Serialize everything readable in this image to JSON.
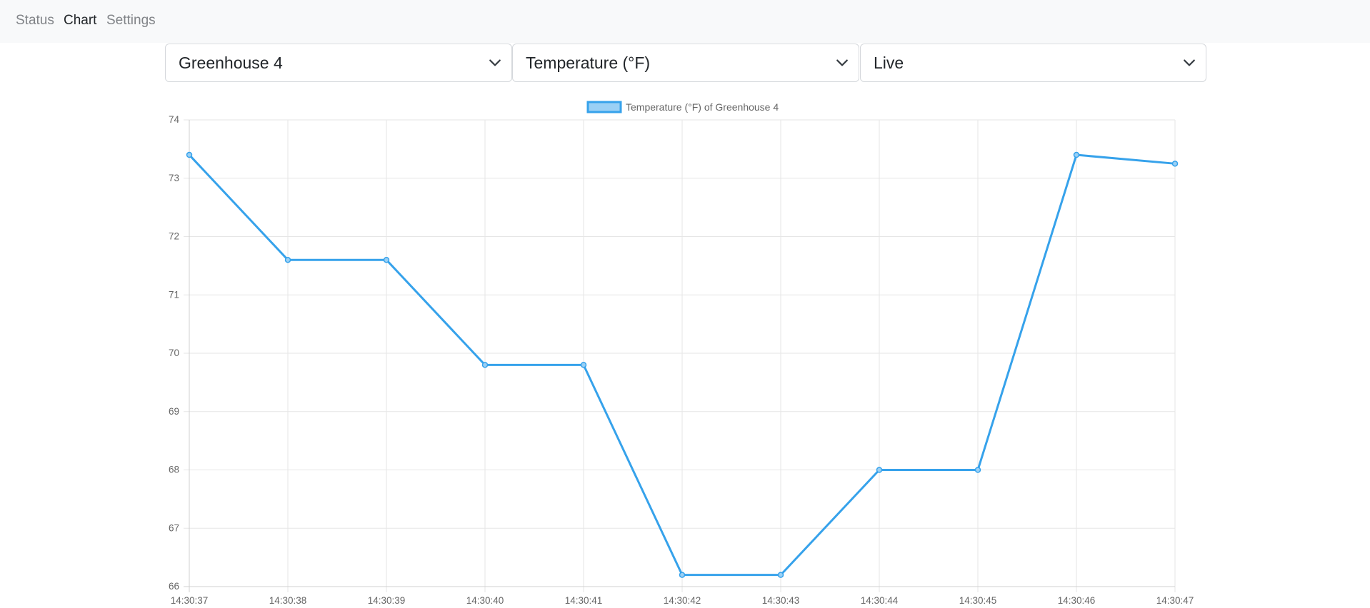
{
  "nav": {
    "items": [
      {
        "label": "Status",
        "active": false
      },
      {
        "label": "Chart",
        "active": true
      },
      {
        "label": "Settings",
        "active": false
      }
    ]
  },
  "controls": {
    "location": "Greenhouse 4",
    "metric": "Temperature (°F)",
    "range": "Live"
  },
  "colors": {
    "series": "#36a2eb",
    "series_fill": "#9ad0f5",
    "grid": "#e6e6e6",
    "navbar_bg": "#f8f9fa"
  },
  "chart_data": {
    "type": "line",
    "title": "",
    "xlabel": "",
    "ylabel": "",
    "x": [
      "14:30:37",
      "14:30:38",
      "14:30:39",
      "14:30:40",
      "14:30:41",
      "14:30:42",
      "14:30:43",
      "14:30:44",
      "14:30:45",
      "14:30:46",
      "14:30:47"
    ],
    "series": [
      {
        "name": "Temperature (°F) of Greenhouse 4",
        "values": [
          73.4,
          71.6,
          71.6,
          69.8,
          69.8,
          66.2,
          66.2,
          68.0,
          68.0,
          73.4,
          73.25
        ]
      }
    ],
    "ylim": [
      66,
      74
    ],
    "yticks": [
      74,
      73,
      72,
      71,
      70,
      69,
      68,
      67,
      66
    ],
    "grid": true,
    "legend": "top-center"
  }
}
